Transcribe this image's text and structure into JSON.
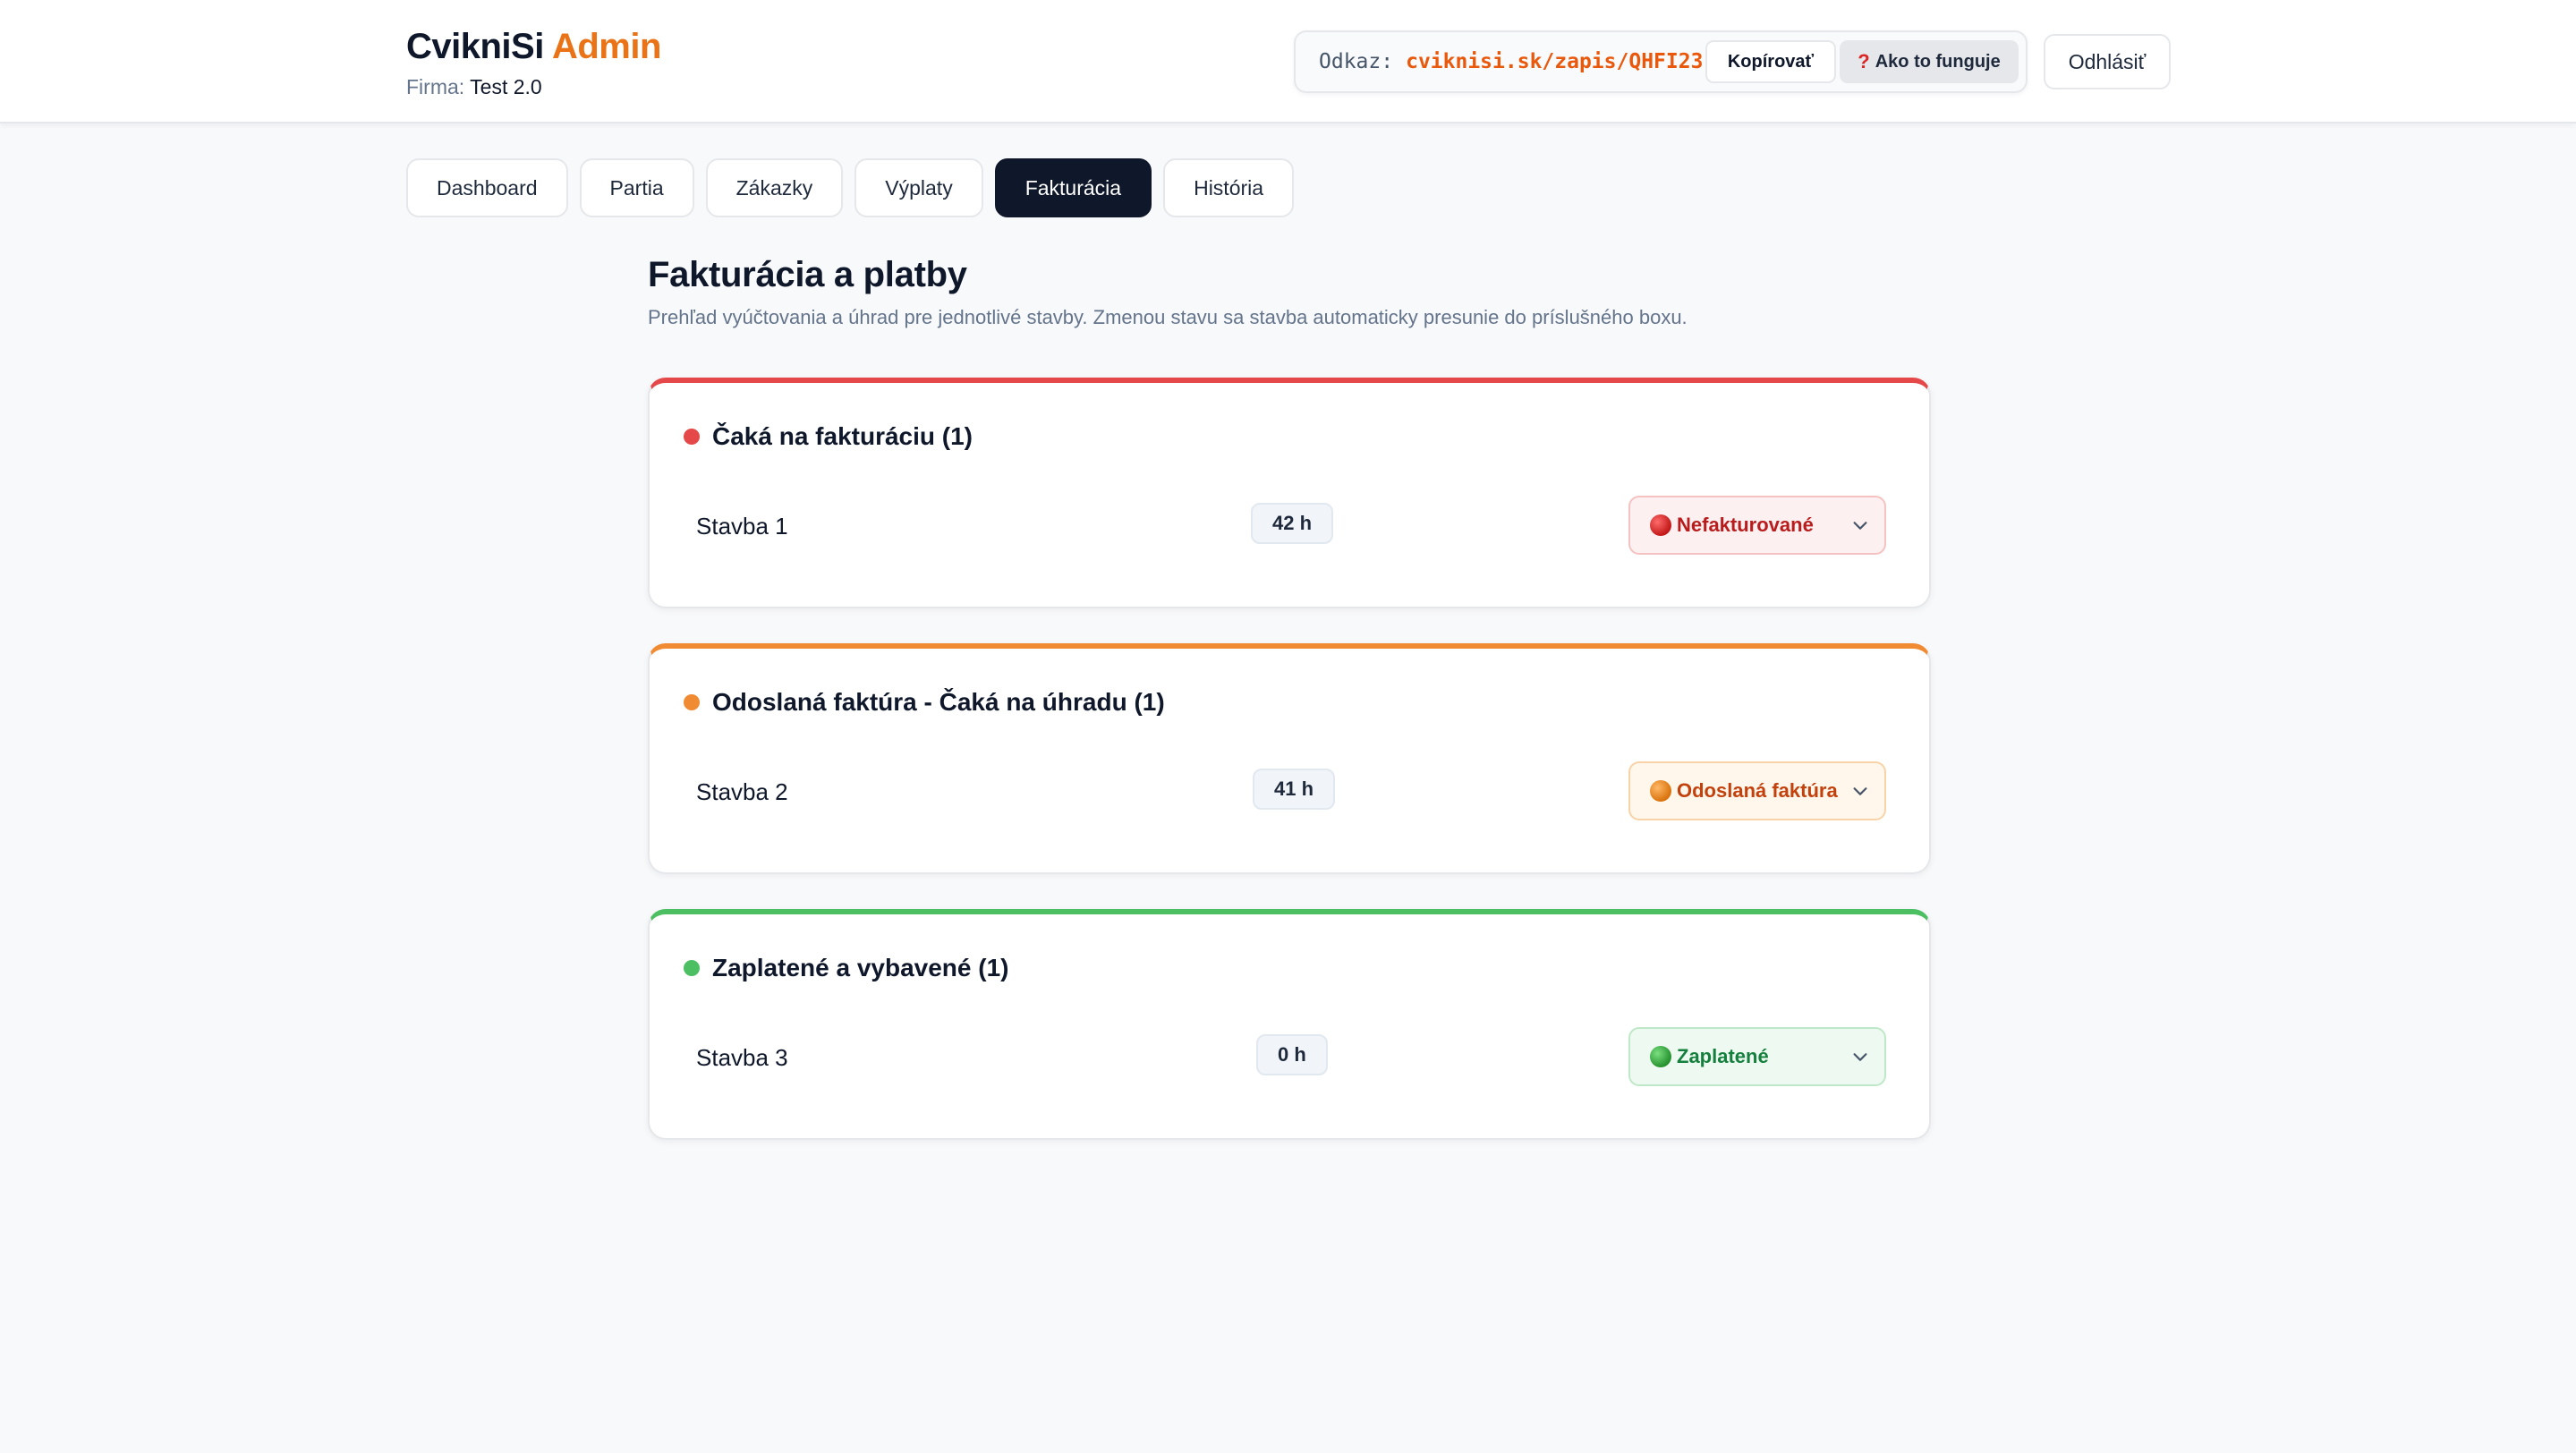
{
  "header": {
    "brand": {
      "name": "CvikniSi",
      "accent": "Admin"
    },
    "company": {
      "label": "Firma:",
      "value": "Test 2.0"
    },
    "link": {
      "label": "Odkaz:",
      "url": "cviknisi.sk/zapis/QHFI23",
      "copy_label": "Kopírovať",
      "help_icon": "?",
      "help_label": "Ako to funguje"
    },
    "logout_label": "Odhlásiť"
  },
  "tabs": [
    {
      "label": "Dashboard",
      "active": false
    },
    {
      "label": "Partia",
      "active": false
    },
    {
      "label": "Zákazky",
      "active": false
    },
    {
      "label": "Výplaty",
      "active": false
    },
    {
      "label": "Fakturácia",
      "active": true
    },
    {
      "label": "História",
      "active": false
    }
  ],
  "main": {
    "title": "Fakturácia a platby",
    "description": "Prehľad vyúčtovania a úhrad pre jednotlivé stavby. Zmenou stavu sa stavba automaticky presunie do príslušného boxu."
  },
  "groups": [
    {
      "title": "Čaká na fakturáciu (1)",
      "color": "#e54848",
      "items": [
        {
          "name": "Stavba 1",
          "hours": "42 h",
          "status": "Nefakturované"
        }
      ]
    },
    {
      "title": "Odoslaná faktúra - Čaká na úhradu (1)",
      "color": "#f08a33",
      "items": [
        {
          "name": "Stavba 2",
          "hours": "41 h",
          "status": "Odoslaná faktúra"
        }
      ]
    },
    {
      "title": "Zaplatené a vybavené (1)",
      "color": "#4cbf63",
      "items": [
        {
          "name": "Stavba 3",
          "hours": "0 h",
          "status": "Zaplatené"
        }
      ]
    }
  ],
  "icons": {
    "status_ball": "circle-icon",
    "dropdown": "chevron-down-icon"
  },
  "colors": {
    "accent": "#ea7317",
    "active_tab": "#0f172a"
  }
}
